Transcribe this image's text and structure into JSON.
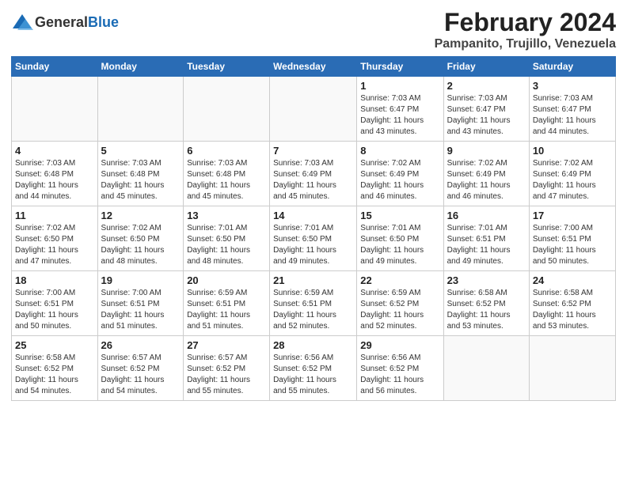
{
  "header": {
    "logo_general": "General",
    "logo_blue": "Blue",
    "title": "February 2024",
    "subtitle": "Pampanito, Trujillo, Venezuela"
  },
  "days_of_week": [
    "Sunday",
    "Monday",
    "Tuesday",
    "Wednesday",
    "Thursday",
    "Friday",
    "Saturday"
  ],
  "weeks": [
    [
      {
        "day": "",
        "info": ""
      },
      {
        "day": "",
        "info": ""
      },
      {
        "day": "",
        "info": ""
      },
      {
        "day": "",
        "info": ""
      },
      {
        "day": "1",
        "info": "Sunrise: 7:03 AM\nSunset: 6:47 PM\nDaylight: 11 hours\nand 43 minutes."
      },
      {
        "day": "2",
        "info": "Sunrise: 7:03 AM\nSunset: 6:47 PM\nDaylight: 11 hours\nand 43 minutes."
      },
      {
        "day": "3",
        "info": "Sunrise: 7:03 AM\nSunset: 6:47 PM\nDaylight: 11 hours\nand 44 minutes."
      }
    ],
    [
      {
        "day": "4",
        "info": "Sunrise: 7:03 AM\nSunset: 6:48 PM\nDaylight: 11 hours\nand 44 minutes."
      },
      {
        "day": "5",
        "info": "Sunrise: 7:03 AM\nSunset: 6:48 PM\nDaylight: 11 hours\nand 45 minutes."
      },
      {
        "day": "6",
        "info": "Sunrise: 7:03 AM\nSunset: 6:48 PM\nDaylight: 11 hours\nand 45 minutes."
      },
      {
        "day": "7",
        "info": "Sunrise: 7:03 AM\nSunset: 6:49 PM\nDaylight: 11 hours\nand 45 minutes."
      },
      {
        "day": "8",
        "info": "Sunrise: 7:02 AM\nSunset: 6:49 PM\nDaylight: 11 hours\nand 46 minutes."
      },
      {
        "day": "9",
        "info": "Sunrise: 7:02 AM\nSunset: 6:49 PM\nDaylight: 11 hours\nand 46 minutes."
      },
      {
        "day": "10",
        "info": "Sunrise: 7:02 AM\nSunset: 6:49 PM\nDaylight: 11 hours\nand 47 minutes."
      }
    ],
    [
      {
        "day": "11",
        "info": "Sunrise: 7:02 AM\nSunset: 6:50 PM\nDaylight: 11 hours\nand 47 minutes."
      },
      {
        "day": "12",
        "info": "Sunrise: 7:02 AM\nSunset: 6:50 PM\nDaylight: 11 hours\nand 48 minutes."
      },
      {
        "day": "13",
        "info": "Sunrise: 7:01 AM\nSunset: 6:50 PM\nDaylight: 11 hours\nand 48 minutes."
      },
      {
        "day": "14",
        "info": "Sunrise: 7:01 AM\nSunset: 6:50 PM\nDaylight: 11 hours\nand 49 minutes."
      },
      {
        "day": "15",
        "info": "Sunrise: 7:01 AM\nSunset: 6:50 PM\nDaylight: 11 hours\nand 49 minutes."
      },
      {
        "day": "16",
        "info": "Sunrise: 7:01 AM\nSunset: 6:51 PM\nDaylight: 11 hours\nand 49 minutes."
      },
      {
        "day": "17",
        "info": "Sunrise: 7:00 AM\nSunset: 6:51 PM\nDaylight: 11 hours\nand 50 minutes."
      }
    ],
    [
      {
        "day": "18",
        "info": "Sunrise: 7:00 AM\nSunset: 6:51 PM\nDaylight: 11 hours\nand 50 minutes."
      },
      {
        "day": "19",
        "info": "Sunrise: 7:00 AM\nSunset: 6:51 PM\nDaylight: 11 hours\nand 51 minutes."
      },
      {
        "day": "20",
        "info": "Sunrise: 6:59 AM\nSunset: 6:51 PM\nDaylight: 11 hours\nand 51 minutes."
      },
      {
        "day": "21",
        "info": "Sunrise: 6:59 AM\nSunset: 6:51 PM\nDaylight: 11 hours\nand 52 minutes."
      },
      {
        "day": "22",
        "info": "Sunrise: 6:59 AM\nSunset: 6:52 PM\nDaylight: 11 hours\nand 52 minutes."
      },
      {
        "day": "23",
        "info": "Sunrise: 6:58 AM\nSunset: 6:52 PM\nDaylight: 11 hours\nand 53 minutes."
      },
      {
        "day": "24",
        "info": "Sunrise: 6:58 AM\nSunset: 6:52 PM\nDaylight: 11 hours\nand 53 minutes."
      }
    ],
    [
      {
        "day": "25",
        "info": "Sunrise: 6:58 AM\nSunset: 6:52 PM\nDaylight: 11 hours\nand 54 minutes."
      },
      {
        "day": "26",
        "info": "Sunrise: 6:57 AM\nSunset: 6:52 PM\nDaylight: 11 hours\nand 54 minutes."
      },
      {
        "day": "27",
        "info": "Sunrise: 6:57 AM\nSunset: 6:52 PM\nDaylight: 11 hours\nand 55 minutes."
      },
      {
        "day": "28",
        "info": "Sunrise: 6:56 AM\nSunset: 6:52 PM\nDaylight: 11 hours\nand 55 minutes."
      },
      {
        "day": "29",
        "info": "Sunrise: 6:56 AM\nSunset: 6:52 PM\nDaylight: 11 hours\nand 56 minutes."
      },
      {
        "day": "",
        "info": ""
      },
      {
        "day": "",
        "info": ""
      }
    ]
  ]
}
